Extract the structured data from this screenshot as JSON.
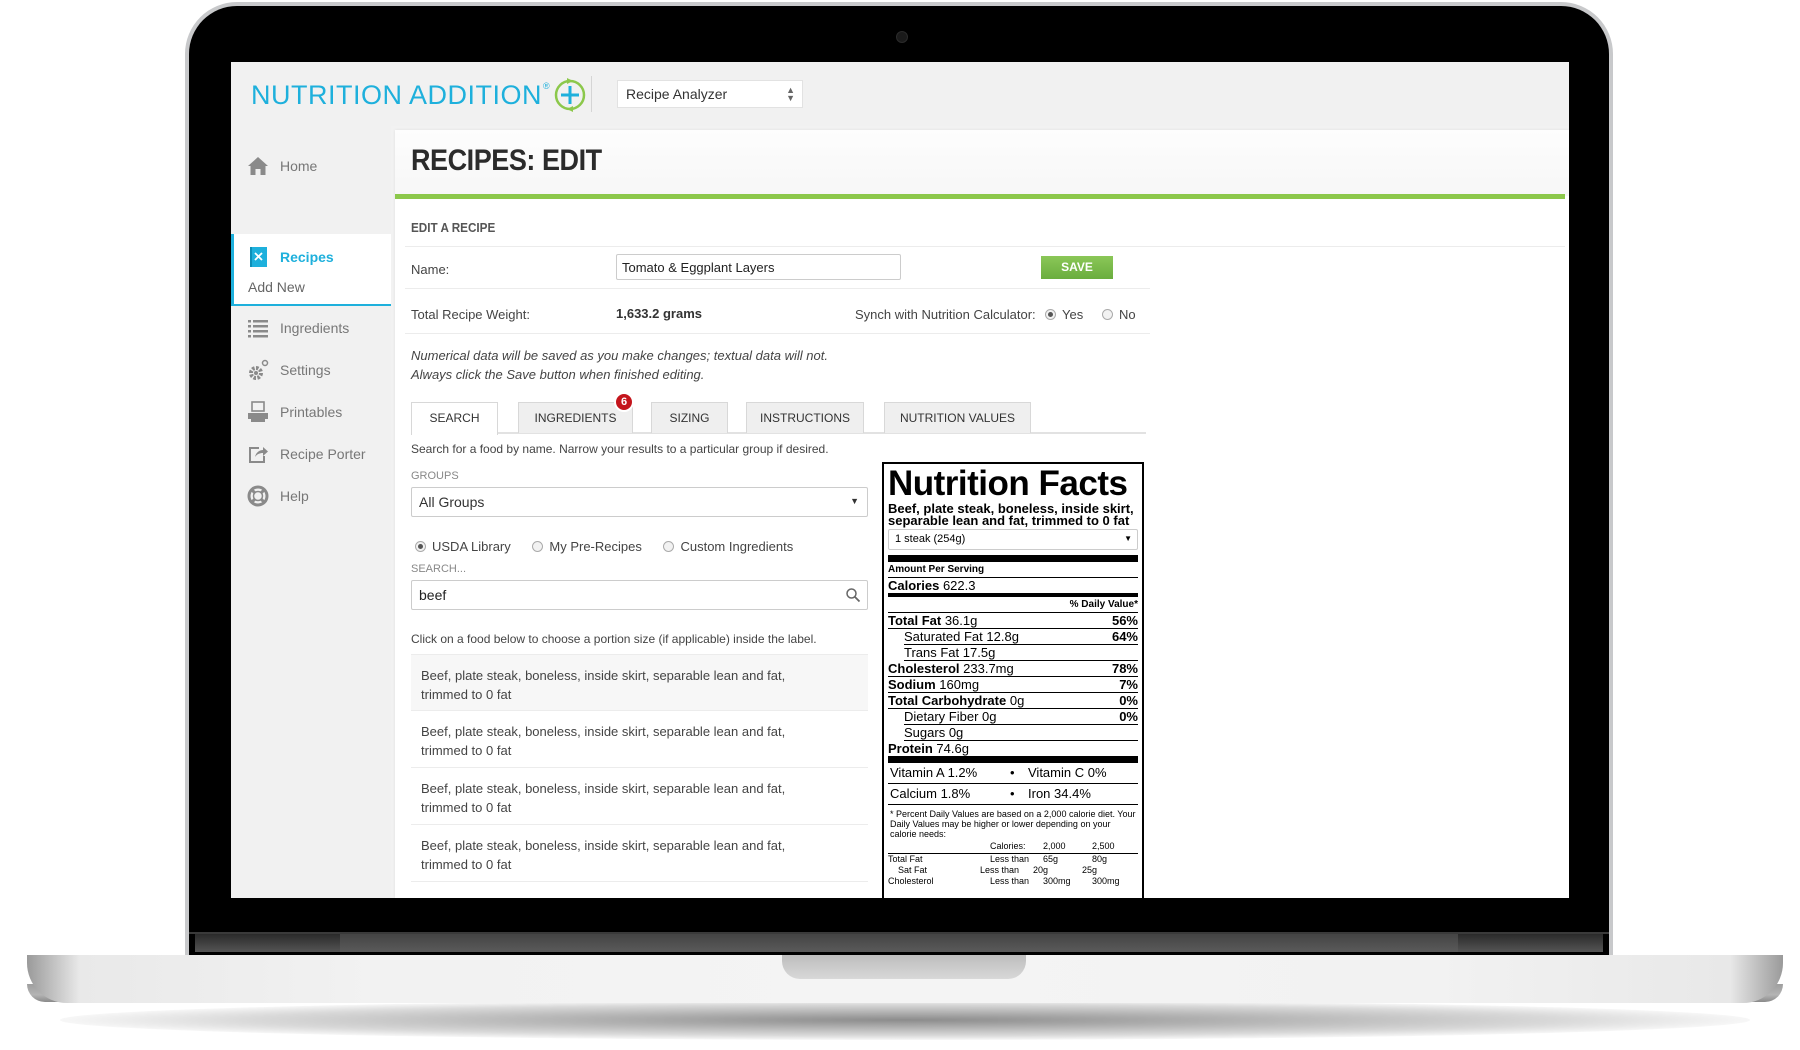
{
  "app": {
    "logo_text": "NUTRITION ADDITION",
    "logo_registered": "®",
    "app_selector": "Recipe Analyzer",
    "brand_color": "#1eb0dc",
    "accent_green": "#8cc84b"
  },
  "sidebar": {
    "items": [
      {
        "label": "Home",
        "icon": "home-icon"
      },
      {
        "label": "Recipes",
        "icon": "recipe-book-icon",
        "active": true
      },
      {
        "label": "Ingredients",
        "icon": "list-icon"
      },
      {
        "label": "Settings",
        "icon": "gears-icon"
      },
      {
        "label": "Printables",
        "icon": "printer-icon"
      },
      {
        "label": "Recipe Porter",
        "icon": "share-icon"
      },
      {
        "label": "Help",
        "icon": "lifebuoy-icon"
      }
    ],
    "sub_item": "Add New"
  },
  "page": {
    "title": "RECIPES: EDIT",
    "section": "EDIT A RECIPE",
    "name_label": "Name:",
    "name_value": "Tomato & Eggplant Layers",
    "save_label": "SAVE",
    "weight_label": "Total Recipe Weight:",
    "weight_value": "1,633.2 grams",
    "synch_label": "Synch with Nutrition Calculator:",
    "synch_yes": "Yes",
    "synch_no": "No",
    "synch_selected": "Yes",
    "note_line1": "Numerical data will be saved as you make changes; textual data will not.",
    "note_line2": "Always click the Save button when finished editing."
  },
  "tabs": [
    {
      "label": "SEARCH",
      "active": true
    },
    {
      "label": "INGREDIENTS",
      "badge": "6"
    },
    {
      "label": "SIZING"
    },
    {
      "label": "INSTRUCTIONS"
    },
    {
      "label": "NUTRITION VALUES"
    }
  ],
  "search": {
    "help": "Search for a food by name. Narrow your results to a particular group if desired.",
    "groups_label": "GROUPS",
    "groups_value": "All Groups",
    "sources": [
      "USDA Library",
      "My Pre-Recipes",
      "Custom Ingredients"
    ],
    "source_selected": "USDA Library",
    "search_label": "SEARCH...",
    "search_value": "beef",
    "click_hint": "Click on a food below to choose a portion size (if applicable) inside the label.",
    "results": [
      {
        "line1": "Beef, plate steak, boneless, inside skirt, separable lean and fat,",
        "line2": "trimmed to 0 fat"
      },
      {
        "line1": "Beef, plate steak, boneless, inside skirt, separable lean and fat,",
        "line2": "trimmed to 0 fat"
      },
      {
        "line1": "Beef, plate steak, boneless, inside skirt, separable lean and fat,",
        "line2": "trimmed to 0 fat"
      },
      {
        "line1": "Beef, plate steak, boneless, inside skirt, separable lean and fat,",
        "line2": "trimmed to 0 fat"
      }
    ]
  },
  "nutrition": {
    "title": "Nutrition Facts",
    "food": "Beef, plate steak, boneless, inside skirt, separable lean and fat, trimmed to 0 fat",
    "serving": "1 steak (254g)",
    "amount_per_serving": "Amount Per Serving",
    "calories_label": "Calories",
    "calories": "622.3",
    "dv_header": "% Daily Value*",
    "rows": [
      {
        "label": "Total Fat",
        "amount": "36.1g",
        "dv": "56%",
        "bold": true
      },
      {
        "label": "Saturated Fat",
        "amount": "12.8g",
        "dv": "64%",
        "indent": true
      },
      {
        "label": "Trans Fat",
        "amount": "17.5g",
        "dv": "",
        "indent": true
      },
      {
        "label": "Cholesterol",
        "amount": "233.7mg",
        "dv": "78%",
        "bold": true
      },
      {
        "label": "Sodium",
        "amount": "160mg",
        "dv": "7%",
        "bold": true
      },
      {
        "label": "Total Carbohydrate",
        "amount": "0g",
        "dv": "0%",
        "bold": true
      },
      {
        "label": "Dietary Fiber",
        "amount": "0g",
        "dv": "0%",
        "indent": true
      },
      {
        "label": "Sugars",
        "amount": "0g",
        "dv": "",
        "indent": true
      },
      {
        "label": "Protein",
        "amount": "74.6g",
        "dv": "",
        "bold": true
      }
    ],
    "vitamins": [
      {
        "left": "Vitamin A 1.2%",
        "right": "Vitamin C 0%"
      },
      {
        "left": "Calcium 1.8%",
        "right": "Iron 34.4%"
      }
    ],
    "footnote": "* Percent Daily Values are based on a 2,000 calorie diet. Your Daily Values may be higher or lower depending on your calorie needs:",
    "table_header": [
      "",
      "Calories:",
      "2,000",
      "2,500"
    ],
    "table_rows": [
      [
        "Total Fat",
        "Less than",
        "65g",
        "80g"
      ],
      [
        "  Sat Fat",
        "Less than",
        "20g",
        "25g"
      ],
      [
        "Cholesterol",
        "Less than",
        "300mg",
        "300mg"
      ]
    ]
  }
}
